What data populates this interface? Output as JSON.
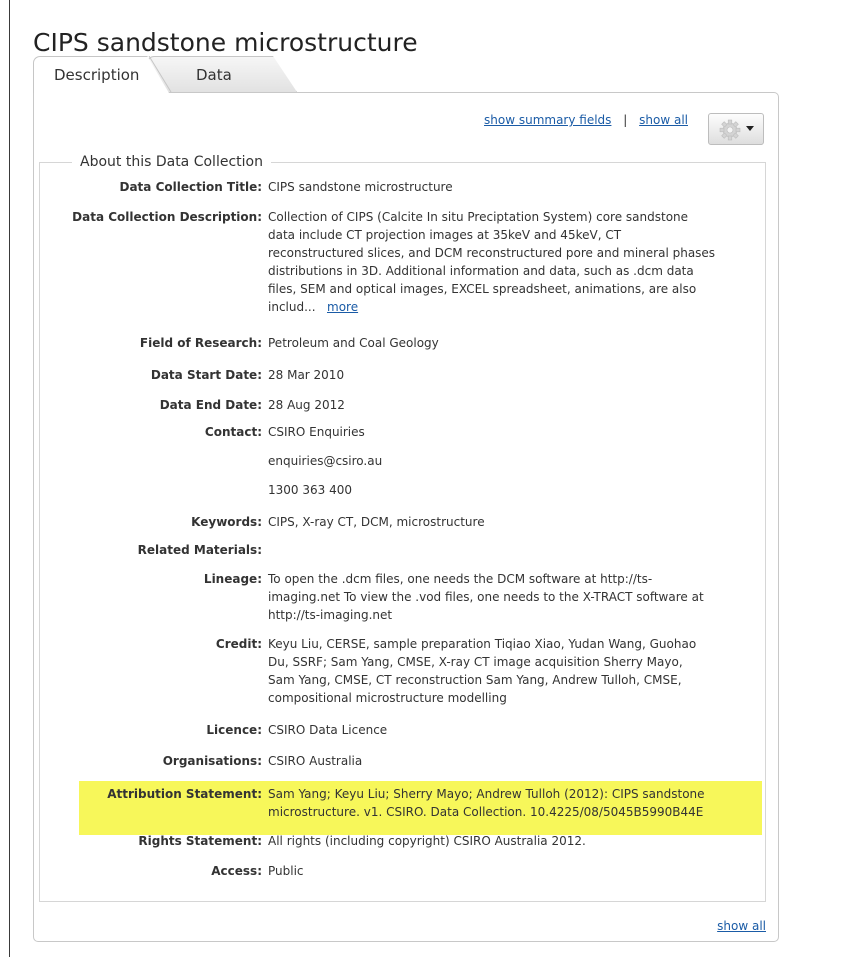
{
  "page": {
    "title": "CIPS sandstone microstructure"
  },
  "tabs": [
    {
      "label": "Description",
      "active": true
    },
    {
      "label": "Data",
      "active": false
    }
  ],
  "toolbar": {
    "show_summary_fields": "show summary fields",
    "separator": "|",
    "show_all": "show all",
    "gear_icon": "gear-icon"
  },
  "section": {
    "legend": "About this Data Collection"
  },
  "fields": {
    "title": {
      "label": "Data Collection Title:",
      "value": "CIPS sandstone microstructure"
    },
    "description": {
      "label": "Data Collection Description:",
      "lines": [
        "Collection of CIPS (Calcite In situ Preciptation System) core sandstone",
        "data include CT projection images at 35keV and 45keV, CT",
        "reconstructured slices, and DCM reconstructured pore and mineral phases",
        "distributions in 3D. Additional information and data, such as .dcm data",
        "files, SEM and optical images, EXCEL spreadsheet, animations, are also"
      ],
      "last_line": "includ...",
      "more": "more"
    },
    "field_of_research": {
      "label": "Field of Research:",
      "value": "Petroleum and Coal Geology"
    },
    "start_date": {
      "label": "Data Start Date:",
      "value": "28 Mar 2010"
    },
    "end_date": {
      "label": "Data End Date:",
      "value": "28 Aug 2012"
    },
    "contact": {
      "label": "Contact:",
      "name": "CSIRO Enquiries",
      "email": "enquiries@csiro.au",
      "phone": "1300 363 400"
    },
    "keywords": {
      "label": "Keywords:",
      "value": "CIPS, X-ray CT, DCM, microstructure"
    },
    "related_materials": {
      "label": "Related Materials:"
    },
    "lineage": {
      "label": "Lineage:",
      "lines": [
        "To open the .dcm files, one needs the DCM software at http://ts-",
        "imaging.net To view the .vod files, one needs to the X-TRACT software at",
        "http://ts-imaging.net"
      ]
    },
    "credit": {
      "label": "Credit:",
      "lines": [
        "Keyu Liu, CERSE, sample preparation Tiqiao Xiao, Yudan Wang, Guohao",
        "Du, SSRF; Sam Yang, CMSE, X-ray CT image acquisition Sherry Mayo,",
        "Sam Yang, CMSE, CT reconstruction Sam Yang, Andrew Tulloh, CMSE,",
        "compositional microstructure modelling"
      ]
    },
    "licence": {
      "label": "Licence:",
      "value": "CSIRO Data Licence"
    },
    "organisations": {
      "label": "Organisations:",
      "value": "CSIRO Australia"
    },
    "attribution": {
      "label": "Attribution Statement:",
      "lines": [
        "Sam Yang; Keyu Liu; Sherry Mayo; Andrew Tulloh (2012): CIPS sandstone",
        "microstructure. v1. CSIRO. Data Collection. 10.4225/08/5045B5990B44E"
      ],
      "highlight_color": "#f7f75a"
    },
    "rights": {
      "label": "Rights Statement:",
      "value": "All rights (including copyright) CSIRO Australia 2012."
    },
    "access": {
      "label": "Access:",
      "value": "Public"
    }
  },
  "footer": {
    "show_all": "show all"
  },
  "colors": {
    "link": "#1a5ba6",
    "highlight": "#f7f75a",
    "border": "#c8c8c8"
  }
}
